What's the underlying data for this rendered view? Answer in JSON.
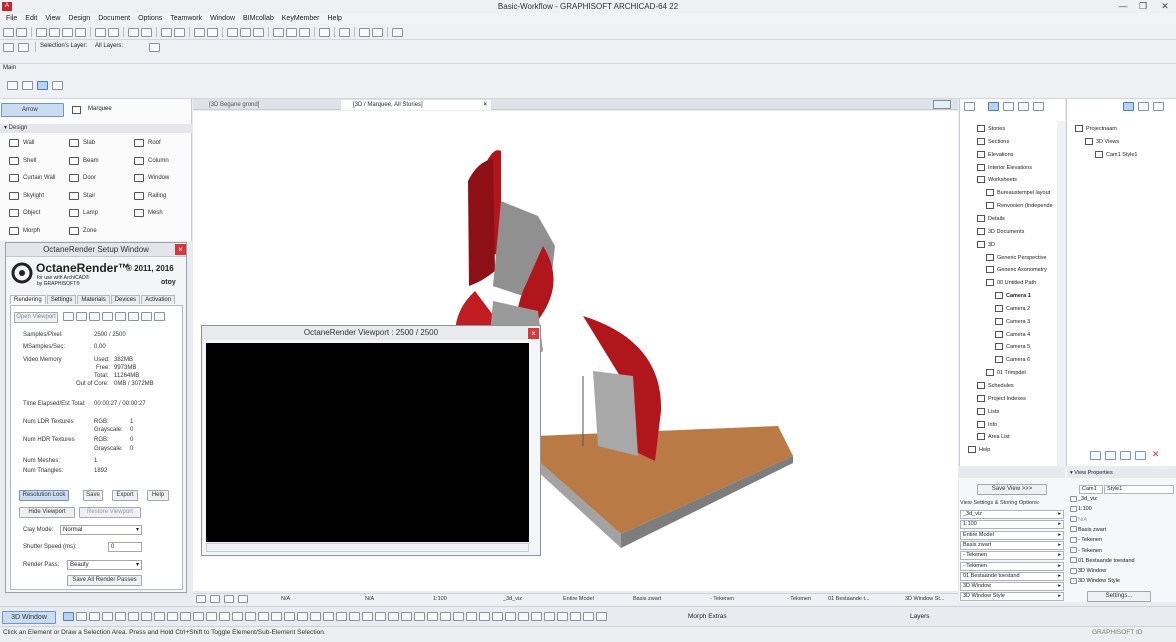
{
  "window": {
    "title": "Basic-Workflow - GRAPHISOFT ARCHICAD-64 22",
    "min": "—",
    "max": "❐",
    "close": "✕"
  },
  "menu": [
    "File",
    "Edit",
    "View",
    "Design",
    "Document",
    "Options",
    "Teamwork",
    "Window",
    "BIMcollab",
    "KeyMember",
    "Help"
  ],
  "toolbar": {
    "selections_layer_label": "Selection's Layer:",
    "all_layers_label": "All Layers:",
    "main_label": "Main"
  },
  "toolbox": {
    "arrow": "Arrow",
    "marquee": "Marquee",
    "design_head": "▾ Design",
    "tools": [
      [
        "Wall",
        "Slab",
        "Roof"
      ],
      [
        "Shell",
        "Beam",
        "Column"
      ],
      [
        "Curtain Wall",
        "Door",
        "Window"
      ],
      [
        "Skylight",
        "Stair",
        "Railing"
      ],
      [
        "Object",
        "Lamp",
        "Mesh"
      ],
      [
        "Morph",
        "Zone",
        ""
      ]
    ]
  },
  "octane_setup": {
    "title": "OctaneRender Setup Window",
    "logo_main": "OctaneRender™",
    "logo_year": "® 2011, 2016",
    "logo_sub1": "for use with ArchiCAD®",
    "logo_sub2": "by GRAPHISOFT®",
    "otoy": "otoy",
    "tabs": [
      "Rendering",
      "Settings",
      "Materials",
      "Devices",
      "Activation"
    ],
    "open_viewport": "Open Viewport",
    "samples_label": "Samples/Pixel:",
    "samples_value": "2500 / 2500",
    "msamples_label": "MSamples/Sec:",
    "msamples_value": "0.00",
    "video_memory_label": "Video Memory",
    "used_label": "Used:",
    "used_value": "382MB",
    "free_label": "Free:",
    "free_value": "9973MB",
    "total_label": "Total:",
    "total_value": "11264MB",
    "outofcore_label": "Out of Core:",
    "outofcore_value": "0MB / 3072MB",
    "time_label": "Time Elapsed/Est Total:",
    "time_value": "00:00:27 / 00:00:27",
    "ldr_label": "Num LDR Textures",
    "hdr_label": "Num HDR Textures",
    "rgb_label": "RGB:",
    "gray_label": "Grayscale:",
    "ldr_rgb": "1",
    "ldr_gray": "0",
    "hdr_rgb": "0",
    "hdr_gray": "0",
    "meshes_label": "Num Meshes:",
    "meshes_value": "1",
    "triangles_label": "Num Triangles:",
    "triangles_value": "1892",
    "resolution_lock": "Resolution Lock",
    "save": "Save",
    "export": "Export",
    "help": "Help",
    "hide_viewport": "Hide Viewport",
    "restore_viewport": "Restore Viewport",
    "clay_label": "Clay Mode:",
    "clay_value": "Normal",
    "shutter_label": "Shutter Speed (ms):",
    "shutter_value": "0",
    "pass_label": "Render Pass:",
    "pass_value": "Beauty",
    "save_all": "Save All Render Passes"
  },
  "viewport": {
    "title": "OctaneRender Viewport : 2500  / 2500"
  },
  "tabs3d": [
    {
      "label": "[3D Begane grond]"
    },
    {
      "label": "[3D / Marquee, All Stories]"
    }
  ],
  "navigator": {
    "items": [
      {
        "label": "Stories",
        "indent": 1
      },
      {
        "label": "Sections",
        "indent": 1
      },
      {
        "label": "Elevations",
        "indent": 1
      },
      {
        "label": "Interior Elevations",
        "indent": 1
      },
      {
        "label": "Worksheets",
        "indent": 1
      },
      {
        "label": "Bureaustempel layout",
        "indent": 2
      },
      {
        "label": "Renvooien (Independe",
        "indent": 2
      },
      {
        "label": "Details",
        "indent": 1
      },
      {
        "label": "3D Documents",
        "indent": 1
      },
      {
        "label": "3D",
        "indent": 1
      },
      {
        "label": "Generic Perspective",
        "indent": 2
      },
      {
        "label": "Generic Axonometry",
        "indent": 2
      },
      {
        "label": "00 Untitled Path",
        "indent": 2
      },
      {
        "label": "Camera 1",
        "indent": 3
      },
      {
        "label": "Camera 2",
        "indent": 3
      },
      {
        "label": "Camera 3",
        "indent": 3
      },
      {
        "label": "Camera 4",
        "indent": 3
      },
      {
        "label": "Camera 5",
        "indent": 3
      },
      {
        "label": "Camera 6",
        "indent": 3
      },
      {
        "label": "01 Trimpdel",
        "indent": 2
      },
      {
        "label": "Schedules",
        "indent": 1
      },
      {
        "label": "Project Indexes",
        "indent": 1
      },
      {
        "label": "Lists",
        "indent": 1
      },
      {
        "label": "Info",
        "indent": 1
      },
      {
        "label": "Area List",
        "indent": 1
      },
      {
        "label": "Help",
        "indent": 0
      }
    ],
    "right_items": [
      {
        "label": "Projectnaam",
        "indent": 0
      },
      {
        "label": "3D Views",
        "indent": 1
      },
      {
        "label": "Cam1 Style1",
        "indent": 2
      }
    ]
  },
  "view_props": {
    "head": "▾ View Properties",
    "save_view": "Save View >>>",
    "storing_label": "View Settings & Storing Options:",
    "left": [
      "_3d_viz",
      "1:100",
      "Entire Model",
      "Basis zwart",
      "- Tekenen",
      "- Tekenen",
      "01 Bestaande toestand",
      "3D Window",
      "3D Window Style"
    ],
    "right_top": [
      "Cam1",
      "Style1"
    ],
    "right": [
      "_3d_viz",
      "1:100",
      "N/A",
      "Basis zwart",
      "- Tekenen",
      "- Tekenen",
      "01 Bestaande toestand",
      "3D Window",
      "3D Window Style"
    ],
    "settings": "Settings..."
  },
  "quick_options": [
    "N/A",
    "N/A",
    "1:100",
    "_3d_viz",
    "Entire Model",
    "Basis zwart",
    "- Tekenen",
    "- Tekenen",
    "01 Bestaande t...",
    "3D Window St..."
  ],
  "bottom": {
    "window_label": "3D Window",
    "morph_extras": "Morph Extras",
    "layers": "Layers"
  },
  "status": {
    "text": "Click an Element or Draw a Selection Area. Press and Hold Ctrl+Shift to Toggle Element/Sub-Element Selection.",
    "brand": "GRAPHISOFT ID"
  },
  "colors": {
    "stair_red": "#b1161c",
    "stair_grey": "#8e8e8e",
    "wood": "#b97a45",
    "accent": "#4a7fbf"
  }
}
